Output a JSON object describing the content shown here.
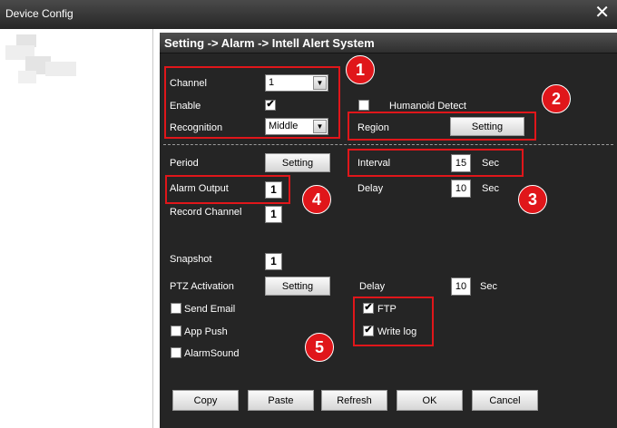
{
  "window": {
    "title": "Device Config",
    "close_icon": "✕"
  },
  "header": {
    "breadcrumb": "Setting -> Alarm -> Intell Alert System"
  },
  "fields": {
    "channel_label": "Channel",
    "channel_value": "1",
    "enable_label": "Enable",
    "enable_checked": true,
    "recognition_label": "Recognition",
    "recognition_value": "Middle",
    "humanoid_label": "Humanoid Detect",
    "humanoid_checked": false,
    "region_label": "Region",
    "region_button": "Setting",
    "period_label": "Period",
    "period_button": "Setting",
    "interval_label": "Interval",
    "interval_value": "15",
    "interval_unit": "Sec",
    "alarm_output_label": "Alarm Output",
    "alarm_output_value": "1",
    "delay_label": "Delay",
    "delay_value": "10",
    "delay_unit": "Sec",
    "record_channel_label": "Record Channel",
    "record_channel_value": "1",
    "snapshot_label": "Snapshot",
    "snapshot_value": "1",
    "ptz_label": "PTZ Activation",
    "ptz_button": "Setting",
    "ptz_delay_label": "Delay",
    "ptz_delay_value": "10",
    "ptz_delay_unit": "Sec",
    "send_email_label": "Send Email",
    "send_email_checked": false,
    "app_push_label": "App Push",
    "app_push_checked": false,
    "alarm_sound_label": "AlarmSound",
    "alarm_sound_checked": false,
    "ftp_label": "FTP",
    "ftp_checked": true,
    "write_log_label": "Write log",
    "write_log_checked": true
  },
  "annotations": [
    "1",
    "2",
    "3",
    "4",
    "5"
  ],
  "footer": {
    "copy": "Copy",
    "paste": "Paste",
    "refresh": "Refresh",
    "ok": "OK",
    "cancel": "Cancel"
  },
  "colors": {
    "panel_bg": "#252525",
    "highlight": "#e0161a",
    "header_bg": "#404040"
  },
  "icons": {
    "check": "✔",
    "dropdown": "▼"
  }
}
